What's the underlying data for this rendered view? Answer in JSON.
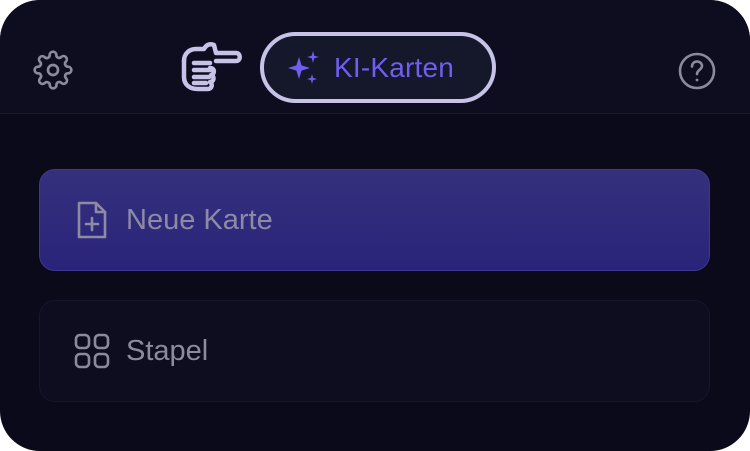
{
  "header": {
    "ai_button": {
      "label": "KI-Karten",
      "icon": "sparkles-icon"
    },
    "settings_icon": "gear-icon",
    "help_icon": "question-circle-icon",
    "pointer_icon": "pointing-hand-icon"
  },
  "actions": [
    {
      "label": "Neue Karte",
      "icon": "new-file-icon"
    },
    {
      "label": "Stapel",
      "icon": "grid-icon"
    }
  ],
  "colors": {
    "background": "#0b0a1b",
    "accent": "#6e5ff0",
    "primary_card": "#2e2979",
    "pill_border": "#c7c3e8",
    "muted_text": "#8c8a9c"
  }
}
